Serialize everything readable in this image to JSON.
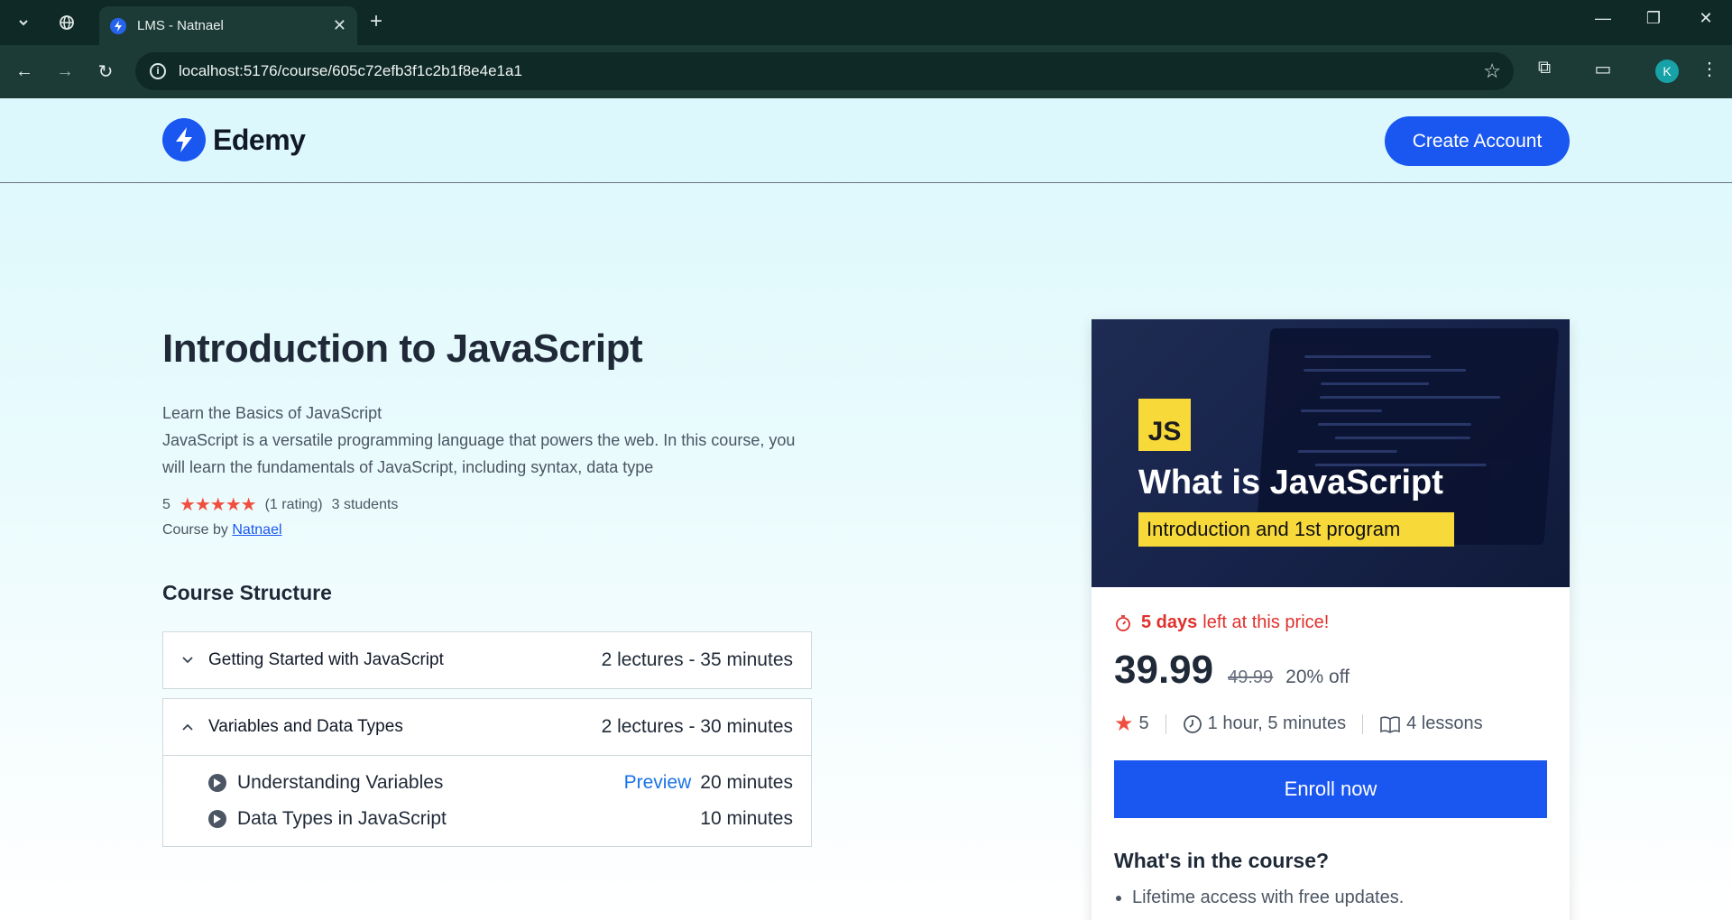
{
  "browser": {
    "tab_title": "LMS - Natnael",
    "url": "localhost:5176/course/605c72efb3f1c2b1f8e4e1a1",
    "profile_initial": "K"
  },
  "site": {
    "brand": "Edemy",
    "create_account": "Create Account"
  },
  "course": {
    "title": "Introduction to JavaScript",
    "description_line1": "Learn the Basics of JavaScript",
    "description_line2": "JavaScript is a versatile programming language that powers the web. In this course, you will learn the fundamentals of JavaScript, including syntax, data type",
    "rating_value": "5",
    "stars": "★★★★★",
    "rating_count": "(1 rating)",
    "students": "3 students",
    "byline_prefix": "Course by",
    "instructor": "Natnael"
  },
  "structure": {
    "title": "Course Structure",
    "chapters": [
      {
        "title": "Getting Started with JavaScript",
        "meta": "2 lectures - 35 minutes",
        "expanded": false
      },
      {
        "title": "Variables and Data Types",
        "meta": "2 lectures - 30 minutes",
        "expanded": true,
        "lectures": [
          {
            "title": "Understanding Variables",
            "preview": "Preview",
            "duration": "20 minutes"
          },
          {
            "title": "Data Types in JavaScript",
            "preview": "",
            "duration": "10 minutes"
          }
        ]
      }
    ]
  },
  "card": {
    "thumb_badge": "JS",
    "thumb_title": "What is JavaScript",
    "thumb_subtitle": "Introduction and 1st program",
    "deadline_bold": "5 days",
    "deadline_rest": "left at this price!",
    "price": "39.99",
    "old_price": "49.99",
    "discount": "20% off",
    "rating": "5",
    "duration": "1 hour, 5 minutes",
    "lessons": "4 lessons",
    "enroll": "Enroll now",
    "whats_title": "What's in the course?",
    "features": [
      "Lifetime access with free updates."
    ]
  },
  "colors": {
    "primary": "#1a56f0",
    "accent_red": "#e0312d",
    "page_bg": "#dcf8fc"
  }
}
